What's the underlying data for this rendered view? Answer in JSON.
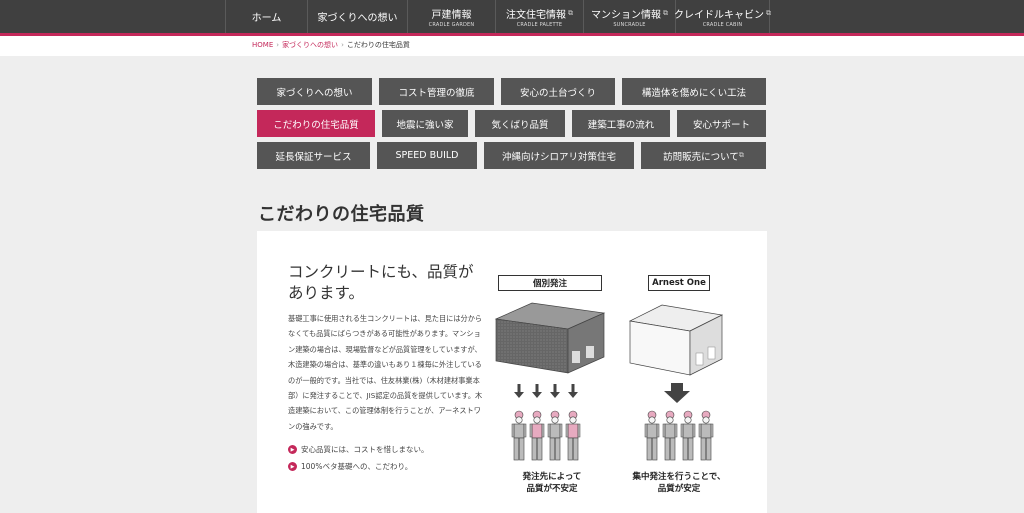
{
  "topnav": {
    "items": [
      {
        "label": "ホーム",
        "sub": "",
        "external": false
      },
      {
        "label": "家づくりへの想い",
        "sub": "",
        "external": false
      },
      {
        "label": "戸建情報",
        "sub": "CRADLE GARDEN",
        "external": false
      },
      {
        "label": "注文住宅情報",
        "sub": "CRADLE PALETTE",
        "external": true
      },
      {
        "label": "マンション情報",
        "sub": "SUNCRADLE",
        "external": true
      },
      {
        "label": "クレイドルキャビン",
        "sub": "CRADLE CABIN",
        "external": true
      }
    ]
  },
  "breadcrumb": {
    "home": "HOME",
    "sep": "›",
    "parent": "家づくりへの想い",
    "current": "こだわりの住宅品質"
  },
  "subnav": {
    "items": [
      {
        "label": "家づくりへの想い",
        "active": false,
        "external": false
      },
      {
        "label": "コスト管理の徹底",
        "active": false,
        "external": false
      },
      {
        "label": "安心の土台づくり",
        "active": false,
        "external": false
      },
      {
        "label": "構造体を傷めにくい工法",
        "active": false,
        "external": false
      },
      {
        "label": "こだわりの住宅品質",
        "active": true,
        "external": false
      },
      {
        "label": "地震に強い家",
        "active": false,
        "external": false
      },
      {
        "label": "気くばり品質",
        "active": false,
        "external": false
      },
      {
        "label": "建築工事の流れ",
        "active": false,
        "external": false
      },
      {
        "label": "安心サポート",
        "active": false,
        "external": false
      },
      {
        "label": "延長保証サービス",
        "active": false,
        "external": false
      },
      {
        "label": "SPEED BUILD",
        "active": false,
        "external": false
      },
      {
        "label": "沖縄向けシロアリ対策住宅",
        "active": false,
        "external": false
      },
      {
        "label": "訪問販売について",
        "active": false,
        "external": true
      }
    ]
  },
  "page_title": "こだわりの住宅品質",
  "content": {
    "lead": "コンクリートにも、品質があります。",
    "body": "基礎工事に使用される生コンクリートは、見た目には分からなくても品質にばらつきがある可能性があります。マンション建築の場合は、現場監督などが品質管理をしていますが、木造建築の場合は、基準の違いもあり１棟毎に外注しているのが一般的です。当社では、住友林業(株)（木材建材事業本部）に発注することで、JIS認定の品質を提供しています。木造建築において、この管理体制を行うことが、アーネストワンの強みです。",
    "bullets": [
      "安心品質には、コストを惜しまない。",
      "100%ベタ基礎への、こだわり。"
    ]
  },
  "illustration": {
    "left_label": "個別発注",
    "right_label": "Arnest One",
    "left_caption_1": "発注先によって",
    "left_caption_2": "品質が不安定",
    "right_caption_1": "集中発注を行うことで、",
    "right_caption_2": "品質が安定"
  },
  "colors": {
    "accent": "#c4285a",
    "nav_bg": "#404040",
    "button_bg": "#555555"
  }
}
